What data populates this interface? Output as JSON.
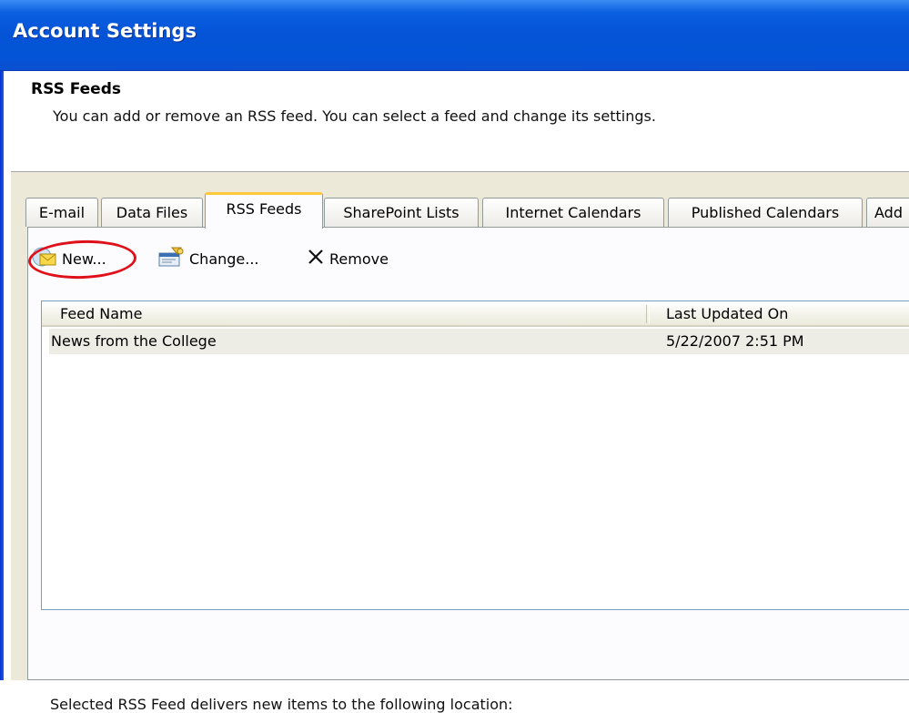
{
  "window": {
    "title": "Account Settings"
  },
  "header": {
    "title": "RSS Feeds",
    "description": "You can add or remove an RSS feed. You can select a feed and change its settings."
  },
  "tabs": [
    {
      "label": "E-mail"
    },
    {
      "label": "Data Files"
    },
    {
      "label": "RSS Feeds",
      "active": true
    },
    {
      "label": "SharePoint Lists"
    },
    {
      "label": "Internet Calendars"
    },
    {
      "label": "Published Calendars"
    },
    {
      "label": "Add"
    }
  ],
  "toolbar": {
    "new_label": "New...",
    "change_label": "Change...",
    "remove_label": "Remove"
  },
  "feed_list": {
    "columns": [
      "Feed Name",
      "Last Updated On"
    ],
    "rows": [
      {
        "feed_name": "News from the College",
        "last_updated": "5/22/2007 2:51 PM"
      }
    ]
  },
  "footer": {
    "location_text": "Selected RSS Feed delivers new items to the following location:"
  },
  "colors": {
    "titlebar": "#0553d6",
    "dialog_bg": "#ece9d8",
    "active_tab_accent": "#ffc83c",
    "highlight_circle": "#e0101a",
    "selected_row": "#eeede5"
  },
  "icons": {
    "new": "rss-envelope-icon",
    "change": "feed-properties-icon",
    "remove": "x-remove-icon"
  }
}
